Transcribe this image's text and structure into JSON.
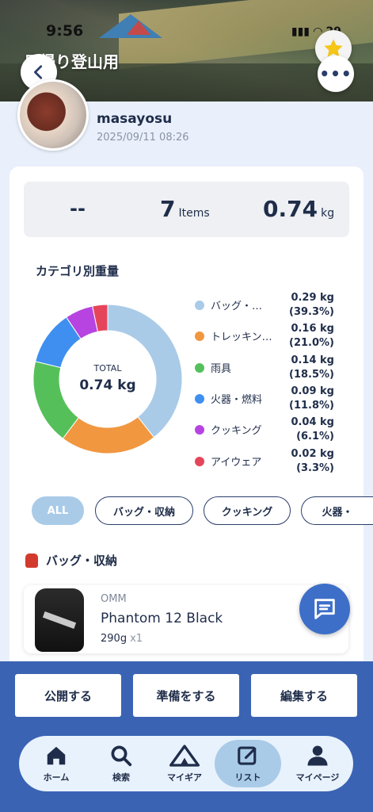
{
  "status_bar": {
    "time": "9:56",
    "battery": "29"
  },
  "header": {
    "title": "日帰り登山用"
  },
  "user": {
    "name": "masayosu",
    "date": "2025/09/11 08:26"
  },
  "stats": {
    "dash": "--",
    "items_count": "7",
    "items_unit": "Items",
    "weight": "0.74",
    "weight_unit": "kg"
  },
  "chart_section": {
    "title": "カテゴリ別重量",
    "total_label": "TOTAL",
    "total_value": "0.74 kg"
  },
  "chart_data": {
    "type": "pie",
    "categories": [
      "バッグ・…",
      "トレッキン…",
      "雨具",
      "火器・燃料",
      "クッキング",
      "アイウェア"
    ],
    "values": [
      0.29,
      0.16,
      0.14,
      0.09,
      0.04,
      0.02
    ],
    "percents": [
      39.3,
      21.0,
      18.5,
      11.8,
      6.1,
      3.3
    ],
    "weight_labels": [
      "0.29 kg",
      "0.16 kg",
      "0.14 kg",
      "0.09 kg",
      "0.04 kg",
      "0.02 kg"
    ],
    "percent_labels": [
      "(39.3%)",
      "(21.0%)",
      "(18.5%)",
      "(11.8%)",
      "(6.1%)",
      "(3.3%)"
    ],
    "colors": [
      "#a9cbe8",
      "#f19740",
      "#55c05a",
      "#3f8ff0",
      "#b744e0",
      "#e5455a"
    ],
    "legend": "right"
  },
  "filters": [
    "ALL",
    "バッグ・収納",
    "クッキング",
    "火器・"
  ],
  "category_header": "バッグ・収納",
  "item": {
    "brand": "OMM",
    "name": "Phantom 12 Black",
    "weight": "290g",
    "qty": "x1"
  },
  "actions": {
    "publish": "公開する",
    "prepare": "準備をする",
    "edit": "編集する"
  },
  "tabs": [
    {
      "label": "ホーム",
      "icon": "home-icon"
    },
    {
      "label": "検索",
      "icon": "search-icon"
    },
    {
      "label": "マイギア",
      "icon": "tent-icon"
    },
    {
      "label": "リスト",
      "icon": "edit-icon"
    },
    {
      "label": "マイページ",
      "icon": "person-icon"
    }
  ]
}
